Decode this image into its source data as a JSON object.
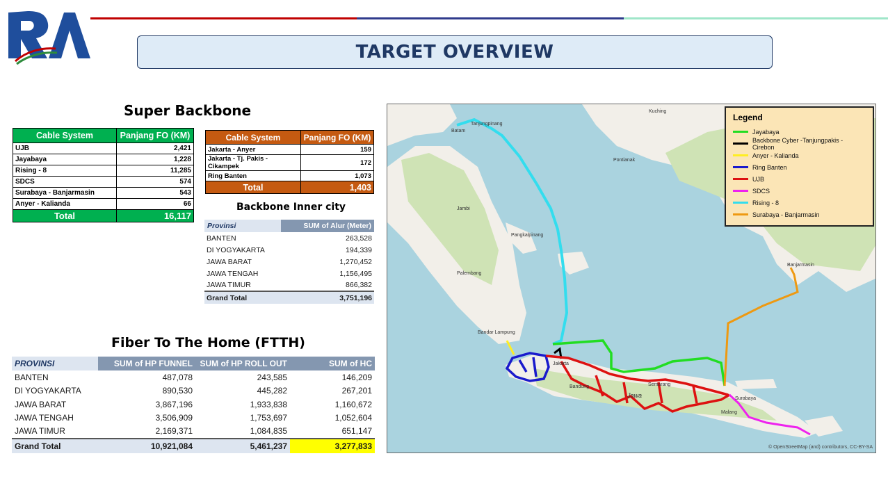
{
  "header": {
    "logo_text": "RA",
    "title": "TARGET OVERVIEW"
  },
  "super_backbone": {
    "title": "Super Backbone",
    "green_table": {
      "headers": [
        "Cable System",
        "Panjang FO (KM)"
      ],
      "rows": [
        [
          "UJB",
          "2,421"
        ],
        [
          "Jayabaya",
          "1,228"
        ],
        [
          "Rising - 8",
          "11,285"
        ],
        [
          "SDCS",
          "574"
        ],
        [
          "Surabaya - Banjarmasin",
          "543"
        ],
        [
          "Anyer - Kalianda",
          "66"
        ]
      ],
      "total": [
        "Total",
        "16,117"
      ]
    },
    "orange_table": {
      "headers": [
        "Cable System",
        "Panjang FO (KM)"
      ],
      "rows": [
        [
          "Jakarta - Anyer",
          "159"
        ],
        [
          "Jakarta - Tj. Pakis - Cikampek",
          "172"
        ],
        [
          "Ring Banten",
          "1,073"
        ]
      ],
      "total": [
        "Total",
        "1,403"
      ]
    }
  },
  "inner_city": {
    "title": "Backbone Inner city",
    "headers": [
      "Provinsi",
      "SUM of Alur (Meter)"
    ],
    "rows": [
      [
        "BANTEN",
        "263,528"
      ],
      [
        "DI YOGYAKARTA",
        "194,339"
      ],
      [
        "JAWA BARAT",
        "1,270,452"
      ],
      [
        "JAWA TENGAH",
        "1,156,495"
      ],
      [
        "JAWA TIMUR",
        "866,382"
      ]
    ],
    "grand_total": [
      "Grand Total",
      "3,751,196"
    ]
  },
  "ftth": {
    "title": "Fiber To The Home (FTTH)",
    "headers": [
      "PROVINSI",
      "SUM of HP FUNNEL",
      "SUM of HP ROLL OUT",
      "SUM of HC"
    ],
    "rows": [
      [
        "BANTEN",
        "487,078",
        "243,585",
        "146,209"
      ],
      [
        "DI YOGYAKARTA",
        "890,530",
        "445,282",
        "267,201"
      ],
      [
        "JAWA BARAT",
        "3,867,196",
        "1,933,838",
        "1,160,672"
      ],
      [
        "JAWA TENGAH",
        "3,506,909",
        "1,753,697",
        "1,052,604"
      ],
      [
        "JAWA TIMUR",
        "2,169,371",
        "1,084,835",
        "651,147"
      ]
    ],
    "grand_total": [
      "Grand Total",
      "10,921,084",
      "5,461,237",
      "3,277,833"
    ]
  },
  "map": {
    "legend_title": "Legend",
    "legend": [
      {
        "label": "Jayabaya",
        "color": "#22dd22"
      },
      {
        "label": "Backbone Cyber -Tanjungpakis - Cirebon",
        "color": "#000000"
      },
      {
        "label": "Anyer - Kalianda",
        "color": "#ffee22"
      },
      {
        "label": "Ring Banten",
        "color": "#1a1acc"
      },
      {
        "label": "UJB",
        "color": "#dd1111"
      },
      {
        "label": "SDCS",
        "color": "#ee22ee"
      },
      {
        "label": "Rising - 8",
        "color": "#33ddee"
      },
      {
        "label": "Surabaya - Banjarmasin",
        "color": "#ee9911"
      }
    ],
    "place_labels": {
      "batam": "Batam",
      "tanjungpinang": "Tanjungpinang",
      "kuching": "Kuching",
      "pontianak": "Pontianak",
      "jambi": "Jambi",
      "palembang": "Palembang",
      "pangkalpinang": "Pangkalpinang",
      "banjarmasin": "Banjarmasin",
      "bandar_lampung": "Bandar Lampung",
      "jakarta": "Jakarta",
      "bandung": "Bandung",
      "semarang": "Semarang",
      "surabaya": "Surabaya",
      "malang": "Malang",
      "jawa": "Jawa"
    },
    "credit": "© OpenStreetMap (and) contributors, CC-BY-SA"
  }
}
